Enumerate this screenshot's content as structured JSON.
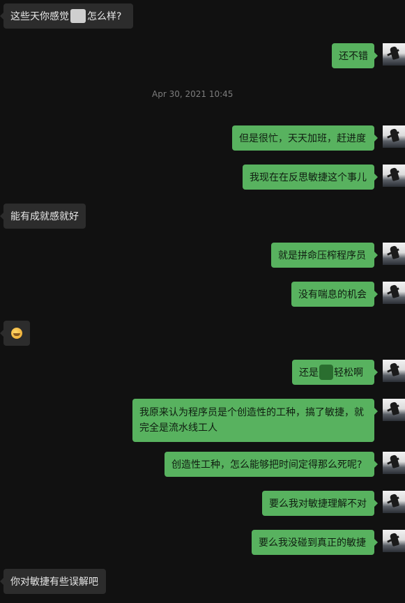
{
  "messages": [
    {
      "side": "left",
      "pre": "这些天你感觉",
      "post": "怎么样?"
    },
    {
      "side": "right",
      "text": "还不错"
    },
    {
      "timestamp": "Apr 30, 2021 10:45"
    },
    {
      "side": "right",
      "text": "但是很忙，天天加班，赶进度"
    },
    {
      "side": "right",
      "text": "我现在在反思敏捷这个事儿"
    },
    {
      "side": "left",
      "text": "能有成就感就好"
    },
    {
      "side": "right",
      "text": "就是拼命压榨程序员"
    },
    {
      "side": "right",
      "text": "没有喘息的机会"
    },
    {
      "side": "left",
      "emoji": "grin-emoji"
    },
    {
      "side": "right",
      "pre": "还是",
      "post": "轻松啊"
    },
    {
      "side": "right",
      "text": "我原来认为程序员是个创造性的工种，搞了敏捷，就完全是流水线工人"
    },
    {
      "side": "right",
      "text": "创造性工种，怎么能够把时间定得那么死呢?"
    },
    {
      "side": "right",
      "text": "要么我对敏捷理解不对"
    },
    {
      "side": "right",
      "text": "要么我没碰到真正的敏捷"
    },
    {
      "side": "left",
      "text": "你对敏捷有些误解吧"
    }
  ]
}
